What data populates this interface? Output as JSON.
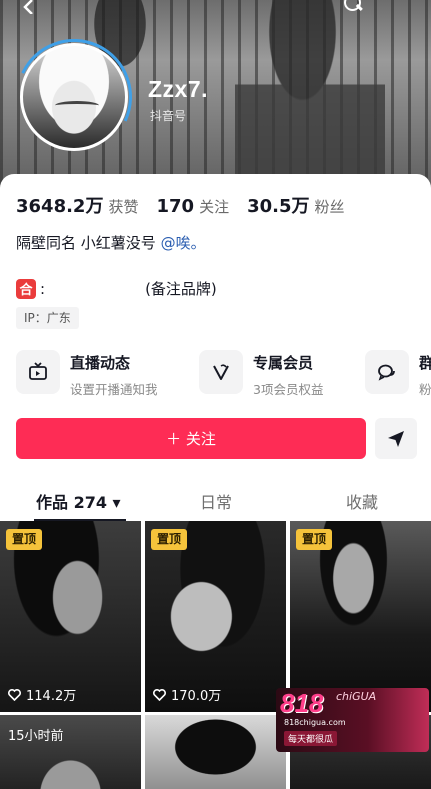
{
  "header": {
    "back_icon": "chevron-left-icon",
    "search_icon": "search-icon"
  },
  "profile": {
    "username": "Zzx7.",
    "account_id_label": "抖音号"
  },
  "stats": [
    {
      "value": "3648.2万",
      "label": "获赞"
    },
    {
      "value": "170",
      "label": "关注"
    },
    {
      "value": "30.5万",
      "label": "粉丝"
    }
  ],
  "bio": {
    "text": "隔壁同名 小红薯没号",
    "mention": "@唉。"
  },
  "brand": {
    "icon_text": "合",
    "colon": ":",
    "note": "(备注品牌)"
  },
  "ip": "IP：广东",
  "features": [
    {
      "title": "直播动态",
      "subtitle": "设置开播通知我",
      "icon": "tv-icon"
    },
    {
      "title": "专属会员",
      "subtitle": "3项会员权益",
      "icon": "v-badge-icon"
    },
    {
      "title": "群",
      "subtitle": "粉",
      "icon": "group-chat-icon"
    }
  ],
  "actions": {
    "follow_label": "＋ 关注",
    "share_icon": "send-icon"
  },
  "tabs": [
    {
      "label": "作品 274 ▾",
      "active": true
    },
    {
      "label": "日常",
      "active": false
    },
    {
      "label": "收藏",
      "active": false
    }
  ],
  "videos": [
    {
      "pinned": "置顶",
      "likes": "114.2万"
    },
    {
      "pinned": "置顶",
      "likes": "170.0万"
    },
    {
      "pinned": "置顶",
      "likes": ""
    },
    {
      "time_ago": "15小时前"
    },
    {},
    {}
  ],
  "watermark": {
    "main": "818",
    "sub": "chiGUA",
    "url": "818chigua.com",
    "slogan": "每天都很瓜"
  },
  "colors": {
    "follow": "#fe2c55",
    "pin": "#f5c33b",
    "mention": "#2a5db0"
  }
}
